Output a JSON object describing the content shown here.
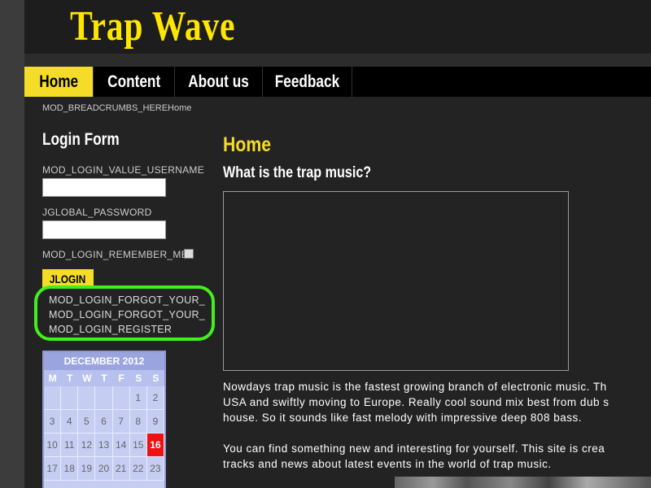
{
  "header": {
    "logo_text": "Trap Wave"
  },
  "nav": {
    "items": [
      "Home",
      "Content",
      "About us",
      "Feedback"
    ],
    "active": "Home"
  },
  "breadcrumb": "MOD_BREADCRUMBS_HEREHome",
  "login": {
    "title": "Login Form",
    "username_label": "MOD_LOGIN_VALUE_USERNAME",
    "password_label": "JGLOBAL_PASSWORD",
    "remember_label": "MOD_LOGIN_REMEMBER_ME",
    "button_label": "JLOGIN",
    "links": [
      "MOD_LOGIN_FORGOT_YOUR_",
      "MOD_LOGIN_FORGOT_YOUR_",
      "MOD_LOGIN_REGISTER"
    ]
  },
  "calendar": {
    "title": "DECEMBER 2012",
    "weekdays": [
      "M",
      "T",
      "W",
      "T",
      "F",
      "S",
      "S"
    ],
    "days": [
      "",
      "",
      "",
      "",
      "",
      "1",
      "2",
      "3",
      "4",
      "5",
      "6",
      "7",
      "8",
      "9",
      "10",
      "11",
      "12",
      "13",
      "14",
      "15",
      "16",
      "17",
      "18",
      "19",
      "20",
      "21",
      "22",
      "23"
    ],
    "today": "16"
  },
  "main": {
    "title": "Home",
    "subtitle": "What is the trap music?",
    "paragraph1": [
      "Nowdays trap music is the fastest growing branch of electronic music. Th",
      "USA and swiftly moving to Europe. Really cool sound mix best from dub s",
      "house. So it sounds like fast melody with impressive deep 808 bass."
    ],
    "paragraph2": [
      "You can find something new and interesting for yourself. This site is crea",
      "tracks and news about latest events in the world of trap music."
    ]
  },
  "colors": {
    "accent": "#f5dc28",
    "highlight": "#44ee1e",
    "calendar_today": "#ee1111"
  }
}
